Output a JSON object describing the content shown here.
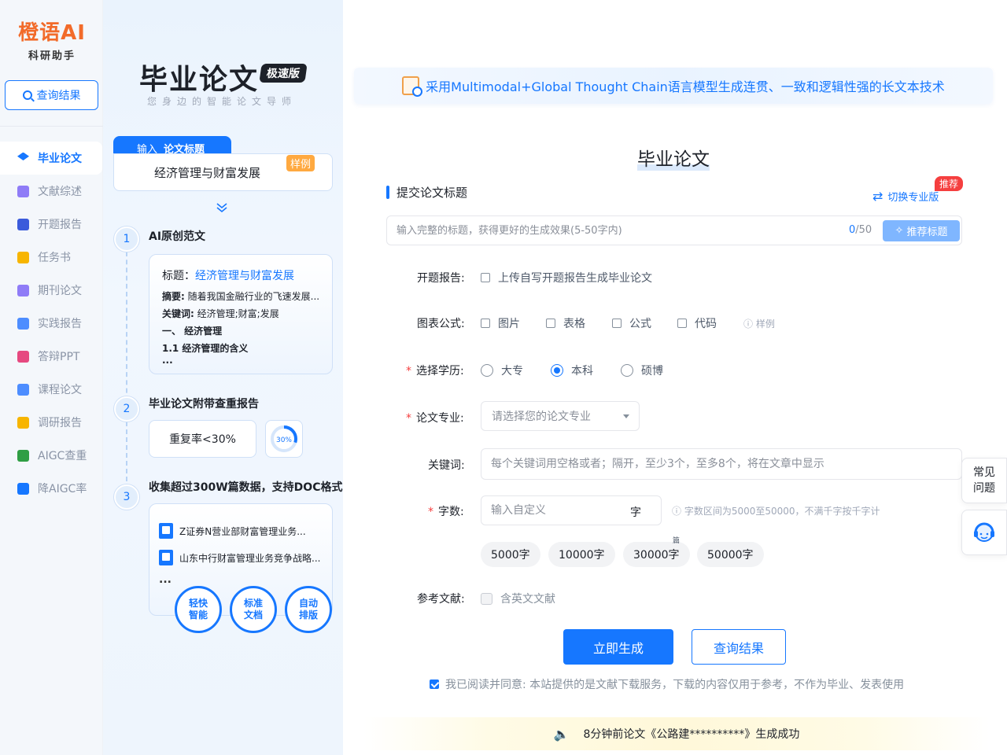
{
  "sidebar": {
    "logo_main": "橙语AI",
    "logo_sub": "科研助手",
    "query_button": "查询结果",
    "items": [
      {
        "label": "毕业论文",
        "icon": "graduation-cap-icon",
        "color": "#1677ff"
      },
      {
        "label": "文献综述",
        "icon": "document-list-icon",
        "color": "#7b61ff"
      },
      {
        "label": "开题报告",
        "icon": "report-icon",
        "color": "#3b5bdb"
      },
      {
        "label": "任务书",
        "icon": "task-icon",
        "color": "#f59f00"
      },
      {
        "label": "期刊论文",
        "icon": "journal-icon",
        "color": "#7b61ff"
      },
      {
        "label": "实践报告",
        "icon": "practice-icon",
        "color": "#1677ff"
      },
      {
        "label": "答辩PPT",
        "icon": "ppt-icon",
        "color": "#e64980"
      },
      {
        "label": "课程论文",
        "icon": "course-icon",
        "color": "#1677ff"
      },
      {
        "label": "调研报告",
        "icon": "survey-icon",
        "color": "#f59f00"
      },
      {
        "label": "AIGC查重",
        "icon": "aigc-check-icon",
        "color": "#2f9e44"
      },
      {
        "label": "降AIGC率",
        "icon": "reduce-aigc-icon",
        "color": "#1677ff"
      }
    ]
  },
  "intro": {
    "title": "毕业论文",
    "badge": "极速版",
    "subtitle": "您身边的智能论文导师",
    "input_tag_prefix": "输入",
    "input_tag_label": "论文标题",
    "sample_title": "经济管理与财富发展",
    "sample_tag": "样例",
    "steps": [
      {
        "num": "1",
        "title": "AI原创范文"
      },
      {
        "num": "2",
        "title": "毕业论文附带查重报告"
      },
      {
        "num": "3",
        "title": "收集超过300W篇数据，支持DOC格式"
      }
    ],
    "card1": {
      "title_label": "标题：",
      "title_value": "经济管理与财富发展",
      "abstract_label": "摘要:",
      "abstract_value": "随着我国金融行业的飞速发展...",
      "keywords_label": "关键词:",
      "keywords_value": "经济管理;财富;发展",
      "h1": "一、 经济管理",
      "h2": "1.1 经济管理的含义",
      "more": "..."
    },
    "repeat_rate": "重复率<30%",
    "ring_value": "30%",
    "docs": [
      "Z证券N营业部财富管理业务...",
      "山东中行财富管理业务竞争战略..."
    ],
    "docs_more": "...",
    "circle_tags": [
      "轻快\n智能",
      "标准\n文档",
      "自动\n排版"
    ]
  },
  "main": {
    "banner": "采用Multimodal+Global Thought Chain语言模型生成连贯、一致和逻辑性强的长文本技术",
    "form_title": "毕业论文",
    "section_title": "提交论文标题",
    "switch_label": "切换专业版",
    "recommend_badge": "推荐",
    "title_placeholder": "输入完整的标题，获得更好的生成效果(5-50字内)",
    "counter_current": "0",
    "counter_max": "/50",
    "recommend_button": "推荐标题",
    "proposal_label": "开题报告:",
    "proposal_option": "上传自写开题报告生成毕业论文",
    "chart_label": "图表公式:",
    "chart_options": [
      "图片",
      "表格",
      "公式",
      "代码"
    ],
    "chart_hint": "样例",
    "degree_label": "选择学历:",
    "degree_options": [
      "大专",
      "本科",
      "硕博"
    ],
    "degree_selected": "本科",
    "major_label": "论文专业:",
    "major_placeholder": "请选择您的论文专业",
    "keyword_label": "关键词:",
    "keyword_placeholder": "每个关键词用空格或者；隔开，至少3个，至多8个，将在文章中显示",
    "wordcount_label": "字数:",
    "wordcount_placeholder": "输入自定义",
    "wordcount_unit": "字",
    "wordcount_hint": "字数区间为5000至50000，不满千字按千字计",
    "wordcount_chips": [
      "5000字",
      "10000字",
      "30000字",
      "50000字"
    ],
    "chip_note": "篇",
    "reference_label": "参考文献:",
    "reference_option": "含英文文献",
    "generate_button": "立即生成",
    "query_button": "查询结果",
    "agree_text": "我已阅读并同意: 本站提供的是文献下载服务，下载的内容仅用于参考，不作为毕业、发表使用",
    "notice": "8分钟前论文《公路建**********》生成成功"
  },
  "floating": {
    "faq": "常见\n问题",
    "service_icon": "customer-service-icon"
  }
}
